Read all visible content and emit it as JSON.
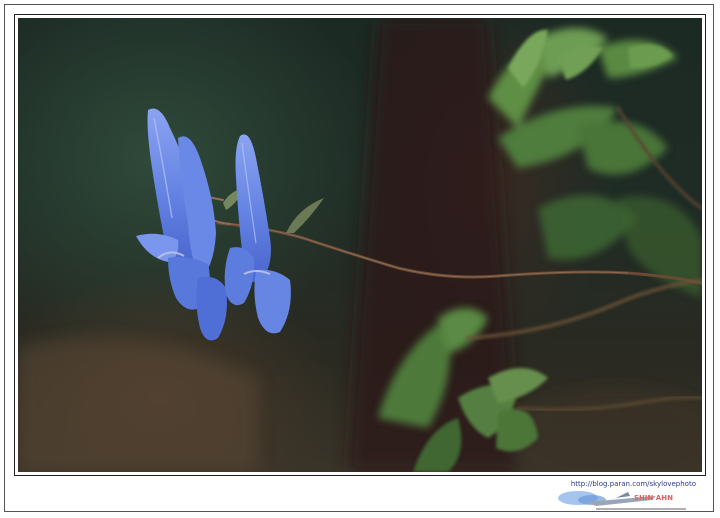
{
  "watermark": {
    "url": "http://blog.paran.com/skylovephoto",
    "logo_text": "SHIN AHN"
  },
  "colors": {
    "flower": "#6f8fe8",
    "leaf": "#5e8f4a",
    "background": "#1f2c25"
  }
}
